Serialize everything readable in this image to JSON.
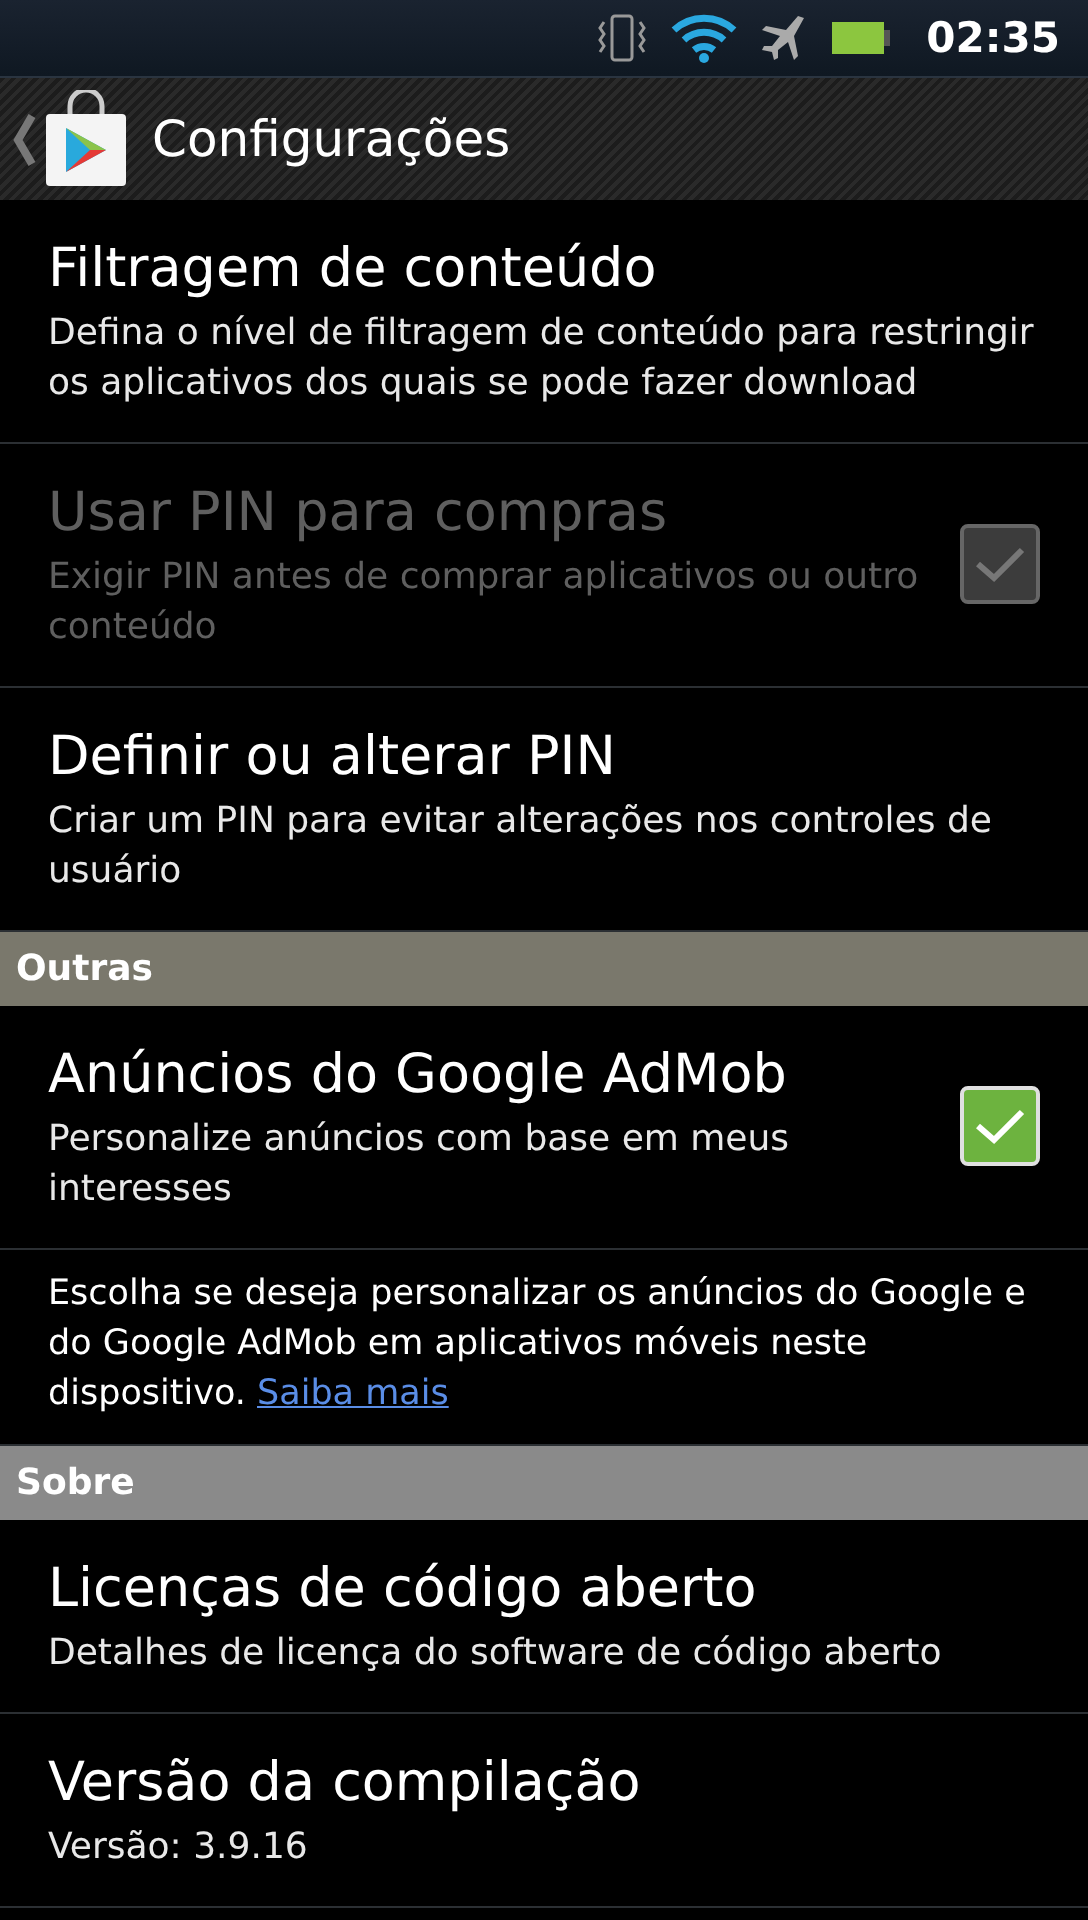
{
  "status_bar": {
    "time": "02:35"
  },
  "action_bar": {
    "title": "Configurações"
  },
  "items": [
    {
      "kind": "setting",
      "title": "Filtragem de conteúdo",
      "summary": "Defina o nível de filtragem de conteúdo para restringir os aplicativos dos quais se pode fazer download"
    },
    {
      "kind": "checkbox",
      "title": "Usar PIN para compras",
      "summary": "Exigir PIN antes de comprar aplicativos ou outro conteúdo",
      "checked": true,
      "disabled": true
    },
    {
      "kind": "setting",
      "title": "Definir ou alterar PIN",
      "summary": "Criar um PIN para evitar alterações nos controles de usuário"
    },
    {
      "kind": "section",
      "title": "Outras",
      "color": "#7a786c"
    },
    {
      "kind": "checkbox",
      "title": "Anúncios do Google AdMob",
      "summary": "Personalize anúncios com base em meus interesses",
      "checked": true,
      "disabled": false
    },
    {
      "kind": "note",
      "text": "Escolha se deseja personalizar os anúncios do Google e do Google AdMob em aplicativos móveis neste dispositivo.",
      "link": "Saiba mais"
    },
    {
      "kind": "section",
      "title": "Sobre",
      "color": "#8a8a8a"
    },
    {
      "kind": "setting",
      "title": "Licenças de código aberto",
      "summary": "Detalhes de licença do software de código aberto"
    },
    {
      "kind": "setting",
      "title": "Versão da compilação",
      "summary": "Versão: 3.9.16"
    }
  ]
}
